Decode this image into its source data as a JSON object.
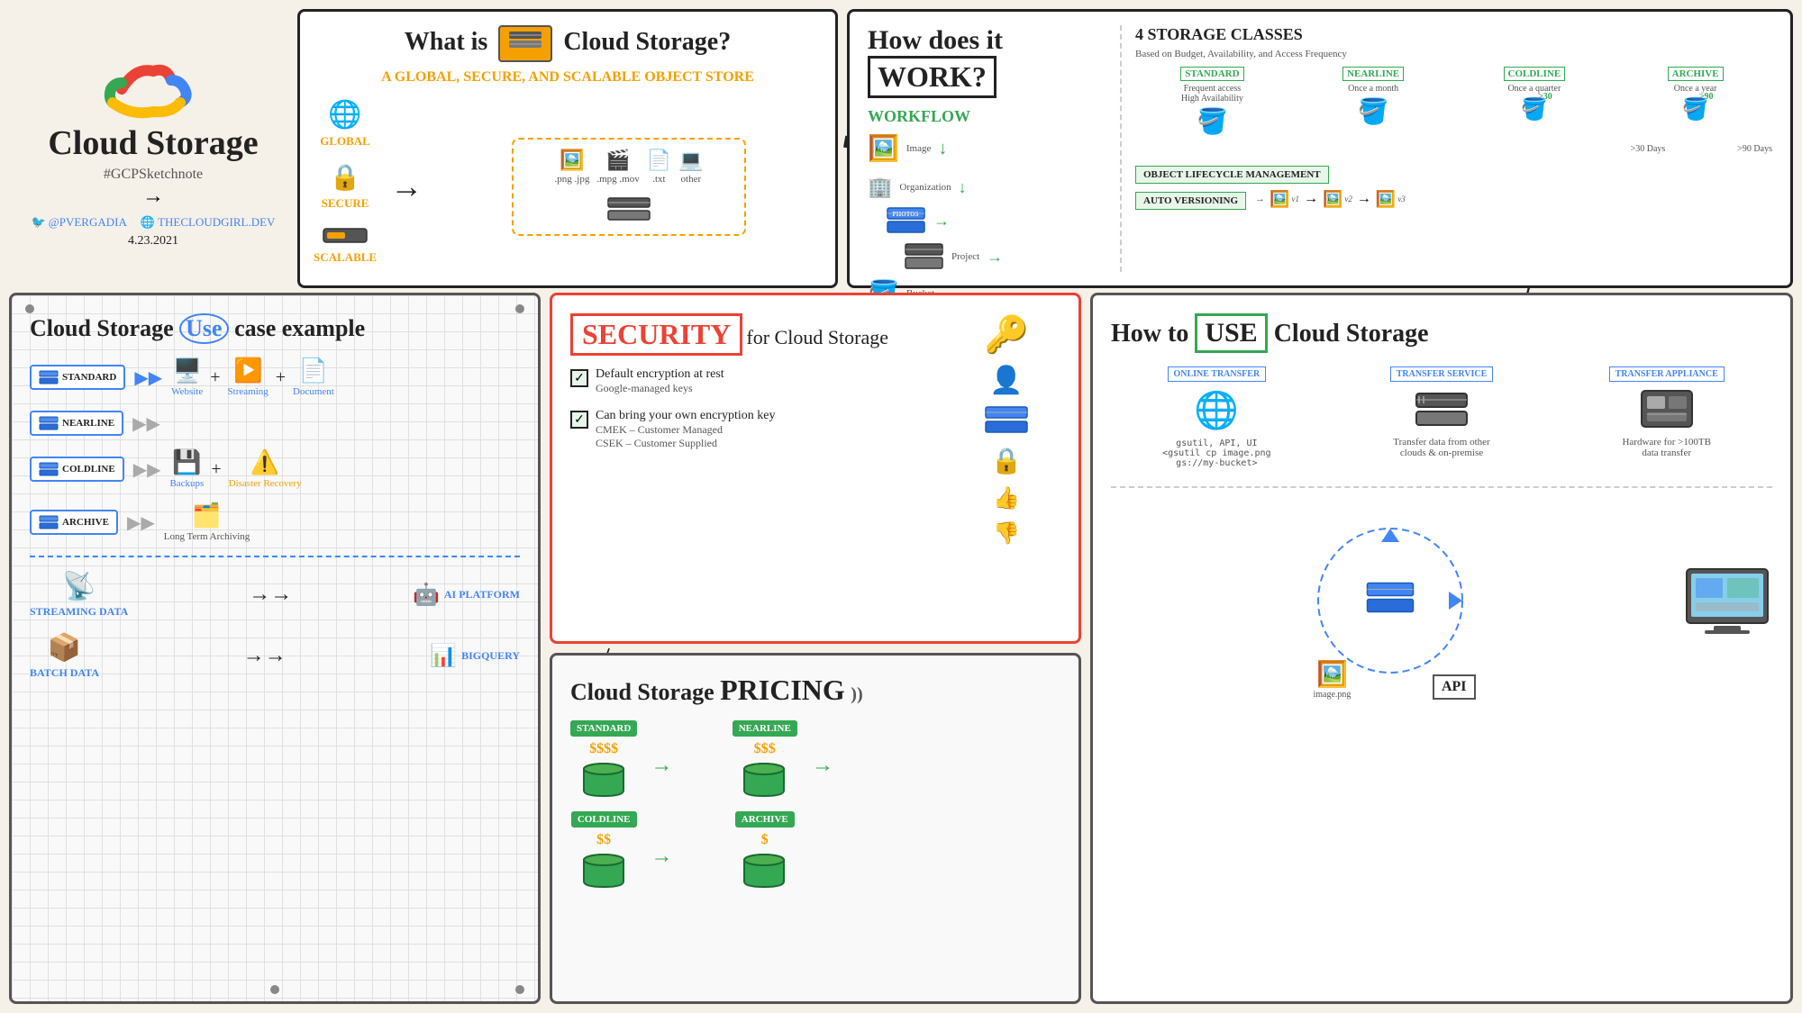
{
  "page": {
    "background": "#f5f0e8"
  },
  "logo": {
    "title": "Cloud Storage",
    "hashtag": "#GCPSketchnote",
    "twitter": "@PVERGADIA",
    "website": "THECLOUDGIRL.DEV",
    "date": "4.23.2021"
  },
  "what_is": {
    "title": "What is",
    "title2": "Cloud Storage?",
    "subtitle": "A GLOBAL, SECURE, AND SCALABLE OBJECT STORE",
    "icon1": "GLOBAL",
    "icon2": "SECURE",
    "icon3": "SCALABLE",
    "file_types": [
      ".png .jpg",
      ".mpg .mov",
      ".txt",
      "other"
    ]
  },
  "how_works": {
    "title": "How does it",
    "title_bold": "WORK?",
    "workflow_title": "WORKFLOW",
    "workflow_items": [
      "Image",
      "Organization",
      "Project",
      "Bucket"
    ],
    "storage_classes_title": "4 STORAGE CLASSES",
    "storage_classes_subtitle": "Based on Budget, Availability, and Access Frequency",
    "classes": [
      {
        "label": "STANDARD",
        "desc": "Frequent access\nHigh Availability"
      },
      {
        "label": "NEARLINE",
        "desc": "Once a month"
      },
      {
        "label": "COLDLINE",
        "desc": "Once a quarter"
      },
      {
        "label": "ARCHIVE",
        "desc": "Once a year"
      }
    ],
    "days1": ">30 Days",
    "days2": ">90 Days",
    "lifecycle": "OBJECT LIFECYCLE MANAGEMENT",
    "autoversioning": "AUTO VERSIONING",
    "versions": "v1  →  v2  →  v3"
  },
  "use_case": {
    "title": "Cloud Storage",
    "use_word": "Use",
    "title2": "case example",
    "rows": [
      {
        "label": "STANDARD",
        "items": [
          "Website",
          "Streaming",
          "Document"
        ]
      },
      {
        "label": "NEARLINE",
        "items": []
      },
      {
        "label": "COLDLINE",
        "items": [
          "Backups",
          "Disaster Recovery"
        ]
      },
      {
        "label": "ARCHIVE",
        "items": [
          "Long Term Archiving"
        ]
      }
    ],
    "streaming_data": "STREAMING DATA",
    "batch_data": "BATCH DATA",
    "ai_platform": "AI PLATFORM",
    "bigquery": "BIGQUERY"
  },
  "security": {
    "title": "SECURITY",
    "subtitle": "for Cloud Storage",
    "item1_title": "Default encryption at rest",
    "item1_desc": "Google-managed keys",
    "item2_title": "Can bring your own encryption key",
    "item2_desc1": "CMEK – Customer Managed",
    "item2_desc2": "CSEK – Customer Supplied"
  },
  "pricing": {
    "title": "Cloud Storage",
    "title_bold": "PRICING",
    "classes": [
      {
        "label": "STANDARD",
        "price": "$$$$"
      },
      {
        "label": "NEARLINE",
        "price": "$$$"
      },
      {
        "label": "COLDLINE",
        "price": "$$"
      },
      {
        "label": "ARCHIVE",
        "price": "$"
      }
    ]
  },
  "how_use": {
    "title": "How to",
    "use_word": "USE",
    "title2": "Cloud Storage",
    "options": [
      {
        "badge": "ONLINE TRANSFER",
        "desc": "gsutil, API, UI\n<gsutil cp image.png\ngs://my-bucket>"
      },
      {
        "badge": "TRANSFER SERVICE",
        "desc": "Transfer data from other\nclouds & on-premise"
      },
      {
        "badge": "TRANSFER APPLIANCE",
        "desc": "Hardware for >100TB\ndata transfer"
      }
    ],
    "api_label": "API",
    "image_label": "image.png"
  }
}
